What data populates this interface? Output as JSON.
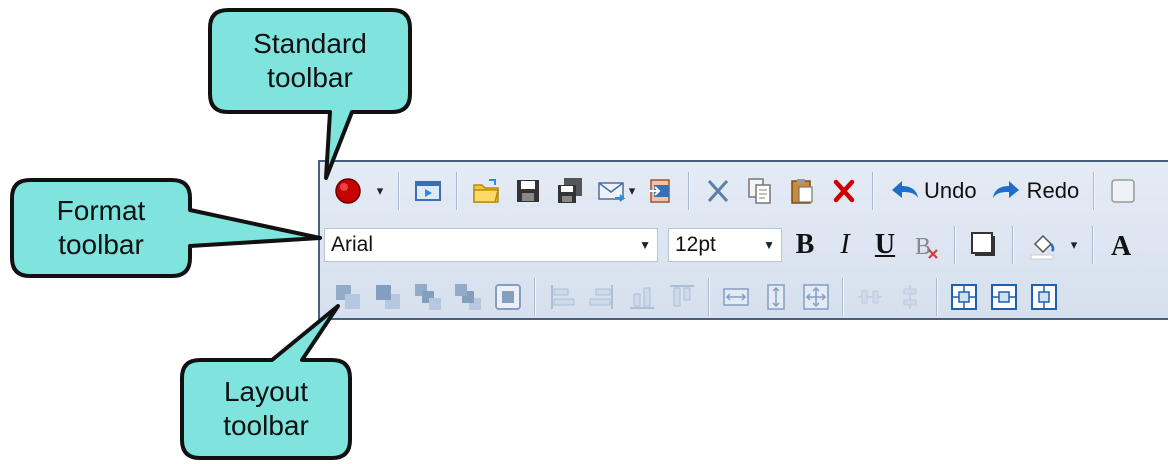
{
  "callouts": {
    "standard": {
      "line1": "Standard",
      "line2": "toolbar"
    },
    "format": {
      "line1": "Format",
      "line2": "toolbar"
    },
    "layout": {
      "line1": "Layout",
      "line2": "toolbar"
    }
  },
  "standard_toolbar": {
    "undo_label": "Undo",
    "redo_label": "Redo"
  },
  "format_toolbar": {
    "font_value": "Arial",
    "size_value": "12pt"
  },
  "colors": {
    "callout_fill": "#7fe3de",
    "callout_border": "#111111",
    "toolbar_bg": "#dde5f0",
    "toolbar_border": "#4a5f7e",
    "record_red": "#c40000",
    "delete_red": "#d10000",
    "arrow_blue": "#1f6fc9"
  }
}
